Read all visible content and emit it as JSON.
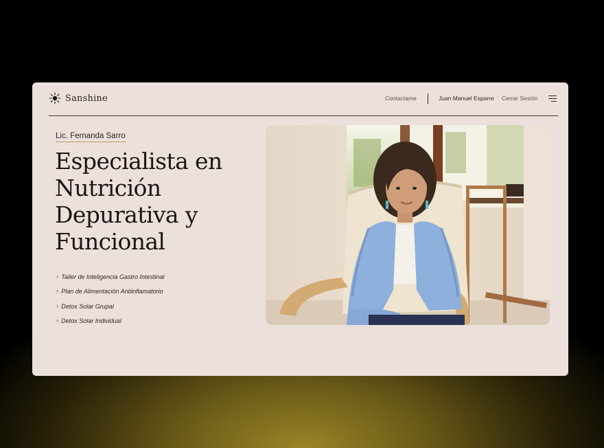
{
  "nav": {
    "brand": "Sanshine",
    "contact": "Contactame",
    "user": "Juan Manuel Esparre",
    "logout": "Cerrar Sesión",
    "menu_icon": "hamburger-icon",
    "brand_icon": "sun-icon"
  },
  "hero": {
    "eyebrow": "Lic. Fernanda Sarro",
    "headline": "Especialista en Nutrición Depurativa y Funcional",
    "services": [
      "Taller de Inteligencia Gastro Intestinal",
      "Plan de Alimentación Antiinflamatorio",
      "Detox Solar Grupal",
      "Detox Solar Individual"
    ],
    "bullet_icon": "plus-icon"
  },
  "colors": {
    "card_bg": "#ece0dc",
    "text_dark": "#1c1714",
    "accent_gold": "#a08c3a"
  }
}
